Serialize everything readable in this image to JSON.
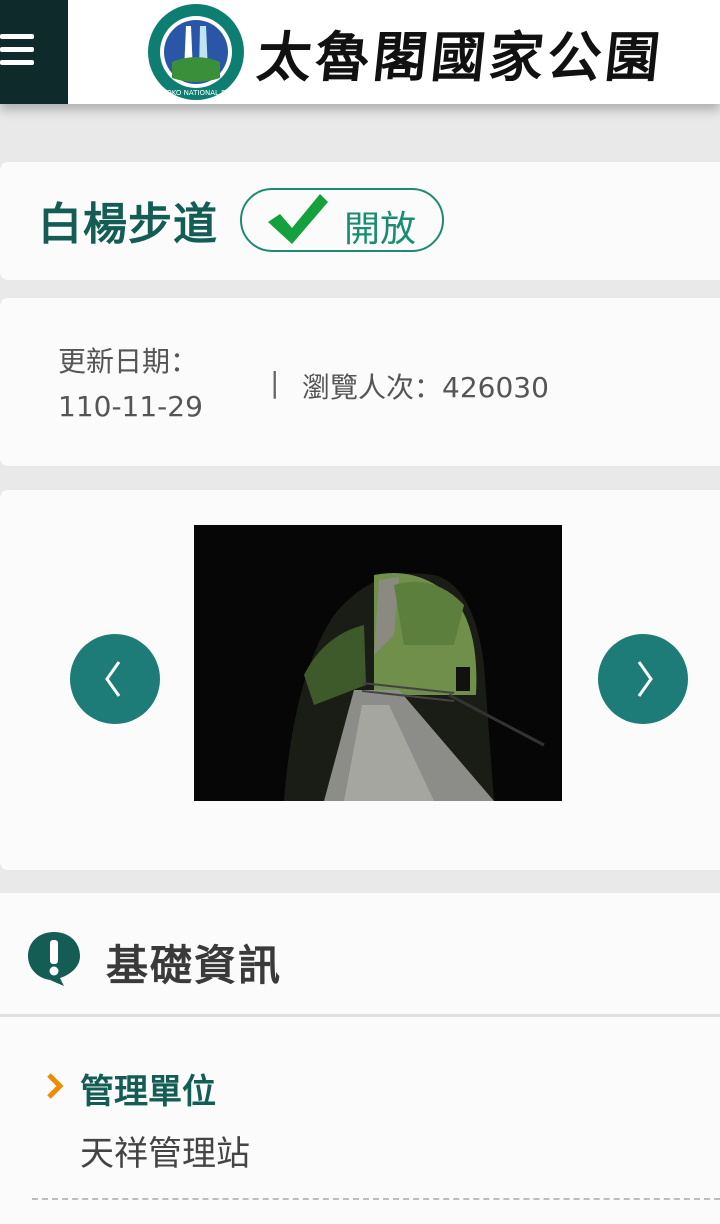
{
  "header": {
    "logo_text": "太魯閣國家公園",
    "logo_subtext": "TAROKO NATIONAL PARK"
  },
  "trail": {
    "name": "白楊步道",
    "status": "開放"
  },
  "meta": {
    "updated_label": "更新日期：",
    "updated_date": "110-11-29",
    "separator": "|",
    "views": "瀏覽人次：426030"
  },
  "info": {
    "section_title": "基礎資訊",
    "management_label": "管理單位",
    "management_value": "天祥管理站"
  },
  "colors": {
    "brand_green": "#135d55",
    "status_green": "#1a8d70",
    "nav_teal": "#1e7c78",
    "accent_orange": "#f08c00"
  }
}
